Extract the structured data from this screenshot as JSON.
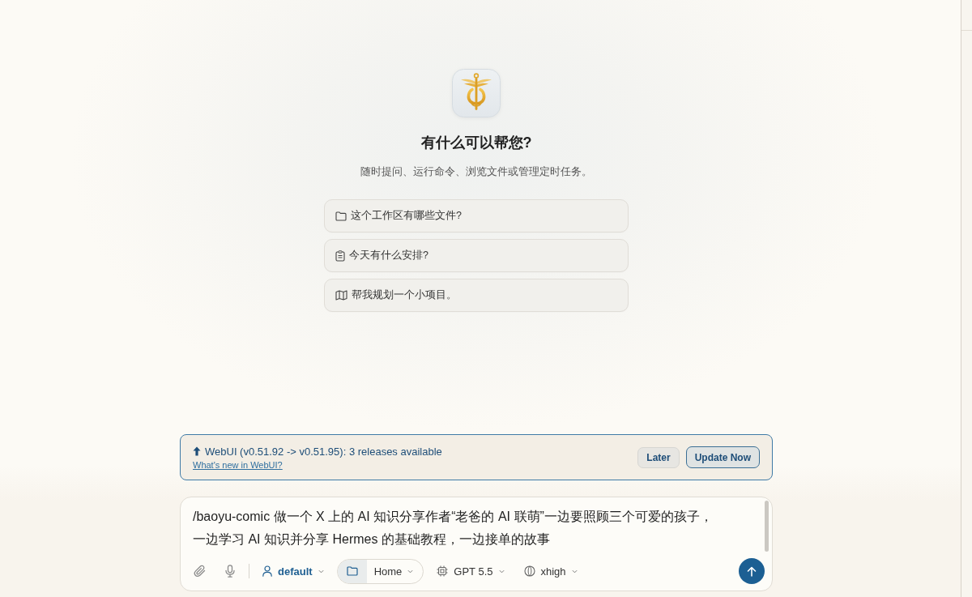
{
  "hero": {
    "title": "有什么可以帮您?",
    "subtitle": "随时提问、运行命令、浏览文件或管理定时任务。"
  },
  "suggestions": [
    "这个工作区有哪些文件?",
    "今天有什么安排?",
    "帮我规划一个小项目。"
  ],
  "update_banner": {
    "message": "WebUI (v0.51.92 -> v0.51.95): 3 releases available",
    "link": "What's new in WebUI?",
    "buttons": [
      {
        "label": "Later",
        "kind": "secondary"
      },
      {
        "label": "Update Now",
        "kind": "primary"
      }
    ]
  },
  "composer": {
    "value": "/baoyu-comic 做一个 X 上的 AI 知识分享作者“老爸的 AI 联萌”一边要照顾三个可爱的孩子，一边学习 AI 知识并分享 Hermes 的基础教程，一边接单的故事",
    "profile": "default",
    "workspace": "Home",
    "model": "GPT 5.5",
    "reasoning": "xhigh"
  }
}
